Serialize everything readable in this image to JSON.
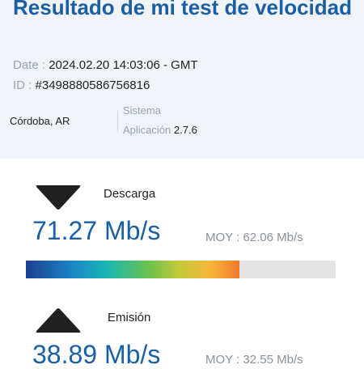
{
  "header": {
    "title": "Resultado de mi test de velocidad",
    "date_label": "Date :",
    "date_value": "2024.02.20 14:03:06 - GMT",
    "id_label": "ID :",
    "id_value": "#3498880586756816",
    "location": "Córdoba, AR",
    "system_label": "Sistema",
    "app_label": "Aplicación",
    "app_version": "2.7.6"
  },
  "download": {
    "label": "Descarga",
    "value": "71.27 Mb/s",
    "average": "MOY : 62.06 Mb/s",
    "bar_fraction": 0.69,
    "icon": "download-arrow-icon"
  },
  "upload": {
    "label": "Emisión",
    "value": "38.89 Mb/s",
    "average": "MOY : 32.55 Mb/s",
    "icon": "upload-arrow-icon"
  },
  "colors": {
    "accent": "#1a5fa3",
    "text": "#222222",
    "muted": "#9aa3ad",
    "header_bg": "#f0f4f8"
  }
}
